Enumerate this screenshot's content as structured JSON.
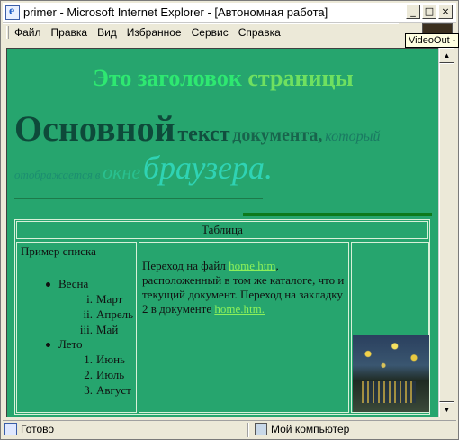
{
  "window": {
    "title": "primer - Microsoft Internet Explorer - [Автономная работа]",
    "buttons": {
      "minimize": "_",
      "maximize": "□",
      "close": "×"
    }
  },
  "menu": [
    "Файл",
    "Правка",
    "Вид",
    "Избранное",
    "Сервис",
    "Справка"
  ],
  "tooltip": "VideoOut - ",
  "page": {
    "heading_part1": "Это заголовок",
    "heading_part2": "страницы",
    "body_words": [
      "Основной",
      "текст",
      "документа,",
      "который",
      "отображается",
      "в",
      "окне",
      "браузера."
    ],
    "table": {
      "caption": "Таблица",
      "list_title": "Пример списка",
      "spring": {
        "label": "Весна",
        "items": [
          {
            "num": "i.",
            "text": "Март"
          },
          {
            "num": "ii.",
            "text": "Апрель"
          },
          {
            "num": "iii.",
            "text": "Май"
          }
        ]
      },
      "summer": {
        "label": "Лето",
        "items": [
          {
            "num": "1.",
            "text": "Июнь"
          },
          {
            "num": "2.",
            "text": "Июль"
          },
          {
            "num": "3.",
            "text": "Август"
          }
        ]
      },
      "paragraph": {
        "text1": "Переход на файл ",
        "link1": "home.htm",
        "text2": ", расположенный в том же каталоге, что и текущий документ. Переход на закладку 2 в документе ",
        "link2": "home.htm."
      }
    }
  },
  "status": {
    "left": "Готово",
    "right": "Мой компьютер"
  },
  "colors": {
    "page_background": "#26a56e",
    "link": "#8df05a"
  }
}
